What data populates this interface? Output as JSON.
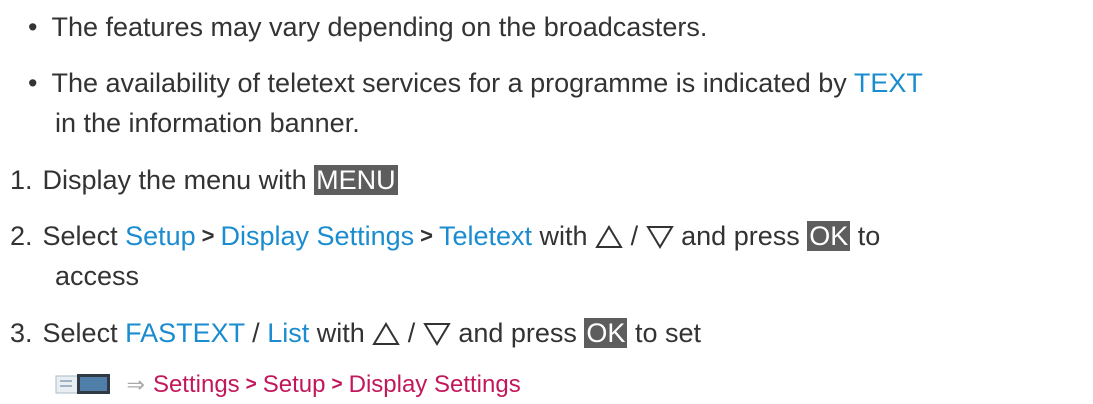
{
  "bullets": [
    {
      "marker": "•",
      "text": "The features may vary depending on the broadcasters."
    },
    {
      "marker": "•",
      "text_before": "The availability of teletext services for a programme is indicated by ",
      "highlight": "TEXT",
      "text_cont": "in the information banner."
    }
  ],
  "steps": [
    {
      "num": "1.",
      "text_before": "Display the menu with ",
      "key": "MENU"
    },
    {
      "num": "2.",
      "word_select": "Select",
      "path": [
        "Setup",
        "Display Settings",
        "Teletext"
      ],
      "sep": ">",
      "word_with": "with",
      "slash": "/",
      "press": "and press",
      "key": "OK",
      "text_after": "to",
      "text_cont": "access"
    },
    {
      "num": "3.",
      "word_select": "Select",
      "options": [
        "FASTEXT",
        "List"
      ],
      "slash": "/",
      "word_with": "with",
      "press": "and press",
      "key": "OK",
      "text_after": "to set"
    }
  ],
  "breadcrumb": {
    "icon": "menu-screen-icon",
    "arrow": "⇒",
    "path": [
      "Settings",
      "Setup",
      "Display Settings"
    ],
    "sep": ">"
  },
  "colors": {
    "link": "#1a8ccf",
    "key_bg": "#5d5d5d",
    "breadcrumb": "#c2185b",
    "text": "#333333"
  }
}
